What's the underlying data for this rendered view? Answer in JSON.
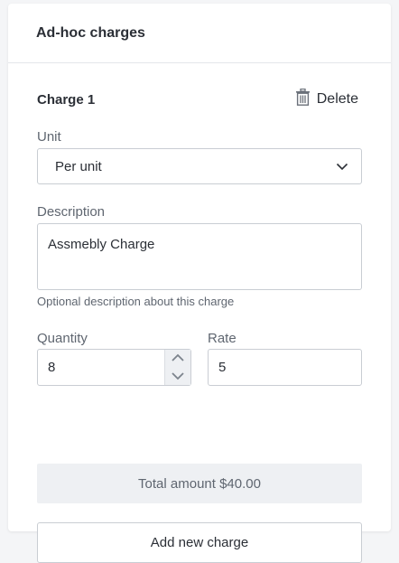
{
  "card": {
    "title": "Ad-hoc charges"
  },
  "charge": {
    "title": "Charge 1",
    "delete_label": "Delete",
    "unit": {
      "label": "Unit",
      "selected": "Per unit"
    },
    "description": {
      "label": "Description",
      "value": "Assmebly Charge",
      "helper": "Optional description about this charge"
    },
    "quantity": {
      "label": "Quantity",
      "value": "8"
    },
    "rate": {
      "label": "Rate",
      "value": "5"
    },
    "total_text": "Total amount $40.00"
  },
  "add_button_label": "Add new charge",
  "icons": {
    "delete": "trash-icon",
    "select": "chevron-down-icon",
    "stepper_up": "chevron-up-icon",
    "stepper_down": "chevron-down-icon"
  },
  "colors": {
    "border": "#c9cdd3",
    "muted_text": "#5f6670",
    "total_bg": "#eef0f3"
  }
}
